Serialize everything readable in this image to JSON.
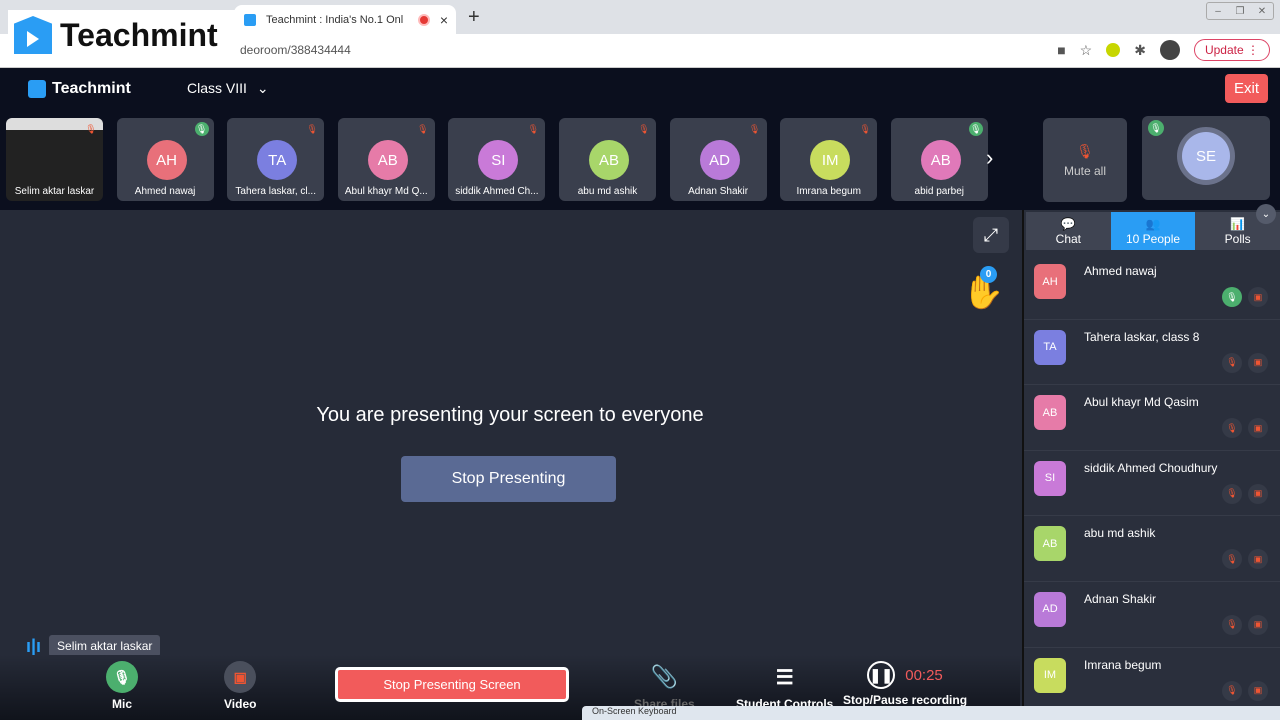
{
  "browser": {
    "tab_title": "Teachmint : India's No.1 Onl",
    "url": "deoroom/388434444",
    "update_label": "Update",
    "new_tab": "+",
    "close_tab": "×",
    "win_min": "–",
    "win_max": "❐",
    "win_close": "✕"
  },
  "brand_overlay": "Teachmint",
  "header": {
    "logo": "Teachmint",
    "class_name": "Class VIII",
    "exit_label": "Exit"
  },
  "strip": {
    "tiles": [
      {
        "name": "Selim aktar laskar",
        "initials": "",
        "color": "",
        "mic": "off",
        "screen": true
      },
      {
        "name": "Ahmed nawaj",
        "initials": "AH",
        "color": "#e8707a",
        "mic": "on"
      },
      {
        "name": "Tahera laskar, cl...",
        "initials": "TA",
        "color": "#7b7fe0",
        "mic": "off"
      },
      {
        "name": "Abul khayr Md Q...",
        "initials": "AB",
        "color": "#e67ba8",
        "mic": "off"
      },
      {
        "name": "siddik Ahmed Ch...",
        "initials": "SI",
        "color": "#c97ad8",
        "mic": "off"
      },
      {
        "name": "abu md ashik",
        "initials": "AB",
        "color": "#a8d66a",
        "mic": "off"
      },
      {
        "name": "Adnan Shakir",
        "initials": "AD",
        "color": "#b97ad8",
        "mic": "off"
      },
      {
        "name": "Imrana begum",
        "initials": "IM",
        "color": "#c8dc5e",
        "mic": "off"
      },
      {
        "name": "abid parbej",
        "initials": "AB",
        "color": "#e079b9",
        "mic": "on"
      }
    ],
    "mute_all_label": "Mute all",
    "self_initials": "SE"
  },
  "stage": {
    "message": "You are presenting your screen to everyone",
    "stop_presenting_label": "Stop Presenting",
    "raised_hands": "0",
    "active_speaker": "Selim aktar laskar"
  },
  "controls": {
    "mic_label": "Mic",
    "video_label": "Video",
    "stop_screen_label": "Stop Presenting Screen",
    "share_files_label": "Share files",
    "student_controls_label": "Student Controls",
    "recording_label": "Stop/Pause recording",
    "recording_time": "00:25"
  },
  "sidebar": {
    "tabs": [
      {
        "label": "Chat",
        "icon": "chat-icon"
      },
      {
        "label": "10 People",
        "icon": "people-icon"
      },
      {
        "label": "Polls",
        "icon": "polls-icon"
      }
    ],
    "active_tab": "10 People",
    "people": [
      {
        "name": "Ahmed nawaj",
        "initials": "AH",
        "color": "#e8707a",
        "mic": "on"
      },
      {
        "name": "Tahera laskar, class 8",
        "initials": "TA",
        "color": "#7b7fe0",
        "mic": "off"
      },
      {
        "name": "Abul khayr Md Qasim",
        "initials": "AB",
        "color": "#e67ba8",
        "mic": "off"
      },
      {
        "name": "siddik Ahmed Choudhury",
        "initials": "SI",
        "color": "#c97ad8",
        "mic": "off"
      },
      {
        "name": "abu md ashik",
        "initials": "AB",
        "color": "#a8d66a",
        "mic": "off"
      },
      {
        "name": "Adnan Shakir",
        "initials": "AD",
        "color": "#b97ad8",
        "mic": "off"
      },
      {
        "name": "Imrana begum",
        "initials": "IM",
        "color": "#c8dc5e",
        "mic": "off"
      }
    ]
  },
  "taskbar": {
    "label": "On-Screen Keyboard"
  }
}
